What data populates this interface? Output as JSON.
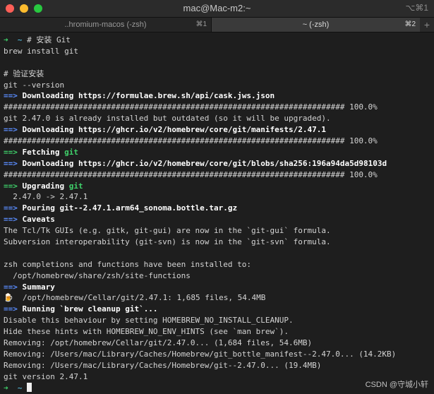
{
  "window": {
    "title": "mac@Mac-m2:~",
    "shortcut": "⌥⌘1"
  },
  "tabs": [
    {
      "label": "..hromium-macos (-zsh)",
      "shortcut": "⌘1"
    },
    {
      "label": "~ (-zsh)",
      "shortcut": "⌘2"
    }
  ],
  "add_tab_label": "+",
  "terminal": {
    "prompt_arrow": "➜",
    "prompt_dir": "~",
    "first_command": "# 安装 Git",
    "lines": [
      "brew install git",
      "",
      "# 验证安装",
      "git --version"
    ],
    "block": [
      {
        "kind": "blue",
        "label": "Downloading",
        "text": " https://formulae.brew.sh/api/cask.jws.json"
      },
      {
        "kind": "plain",
        "text": "######################################################################### 100.0%"
      },
      {
        "kind": "plain",
        "text": "git 2.47.0 is already installed but outdated (so it will be upgraded)."
      },
      {
        "kind": "blue",
        "label": "Downloading",
        "text": " https://ghcr.io/v2/homebrew/core/git/manifests/2.47.1"
      },
      {
        "kind": "plain",
        "text": "######################################################################### 100.0%"
      },
      {
        "kind": "green",
        "label": "Fetching",
        "pkg": " git"
      },
      {
        "kind": "blue",
        "label": "Downloading",
        "text": " https://ghcr.io/v2/homebrew/core/git/blobs/sha256:196a94da5d98103d"
      },
      {
        "kind": "plain",
        "text": "######################################################################### 100.0%"
      },
      {
        "kind": "green",
        "label": "Upgrading",
        "pkg": " git"
      },
      {
        "kind": "plain",
        "text": "  2.47.0 -> 2.47.1"
      },
      {
        "kind": "blue",
        "label": "Pouring",
        "text": " git--2.47.1.arm64_sonoma.bottle.tar.gz"
      },
      {
        "kind": "blue",
        "label": "Caveats",
        "text": ""
      },
      {
        "kind": "plain",
        "text": "The Tcl/Tk GUIs (e.g. gitk, git-gui) are now in the `git-gui` formula."
      },
      {
        "kind": "plain",
        "text": "Subversion interoperability (git-svn) is now in the `git-svn` formula."
      },
      {
        "kind": "plain",
        "text": ""
      },
      {
        "kind": "plain",
        "text": "zsh completions and functions have been installed to:"
      },
      {
        "kind": "plain",
        "text": "  /opt/homebrew/share/zsh/site-functions"
      },
      {
        "kind": "blue",
        "label": "Summary",
        "text": ""
      },
      {
        "kind": "plain",
        "text": "🍺  /opt/homebrew/Cellar/git/2.47.1: 1,685 files, 54.4MB"
      },
      {
        "kind": "blue",
        "label": "Running",
        "text": " `brew cleanup git`..."
      },
      {
        "kind": "plain",
        "text": "Disable this behaviour by setting HOMEBREW_NO_INSTALL_CLEANUP."
      },
      {
        "kind": "plain",
        "text": "Hide these hints with HOMEBREW_NO_ENV_HINTS (see `man brew`)."
      },
      {
        "kind": "plain",
        "text": "Removing: /opt/homebrew/Cellar/git/2.47.0... (1,684 files, 54.6MB)"
      },
      {
        "kind": "plain",
        "text": "Removing: /Users/mac/Library/Caches/Homebrew/git_bottle_manifest--2.47.0... (14.2KB)"
      },
      {
        "kind": "plain",
        "text": "Removing: /Users/mac/Library/Caches/Homebrew/git--2.47.0... (19.4MB)"
      },
      {
        "kind": "plain",
        "text": "git version 2.47.1"
      }
    ],
    "arrow_marker": "==>"
  },
  "watermark": "CSDN @守城小轩"
}
